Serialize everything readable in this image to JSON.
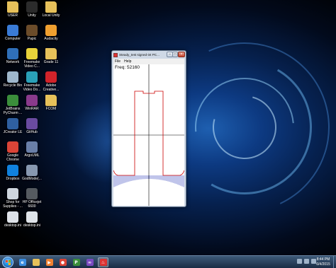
{
  "desktop": {
    "icons": [
      {
        "label": "USER",
        "icon": "folder-icon",
        "color": "#e7c15a"
      },
      {
        "label": "Unity",
        "icon": "unity-icon",
        "color": "#2b2b2b"
      },
      {
        "label": "Local Unity",
        "icon": "folder-icon",
        "color": "#e7c15a"
      },
      {
        "label": "Computer",
        "icon": "computer-icon",
        "color": "#3a7bd5"
      },
      {
        "label": "Papic",
        "icon": "papic-icon",
        "color": "#6b4c2a"
      },
      {
        "label": "Audacity",
        "icon": "audacity-icon",
        "color": "#f0a030"
      },
      {
        "label": "Network",
        "icon": "network-icon",
        "color": "#2f6fb8"
      },
      {
        "label": "Freemake Video C...",
        "icon": "freemake-icon",
        "color": "#e8d23a"
      },
      {
        "label": "Grade 11",
        "icon": "folder-icon",
        "color": "#e7c15a"
      },
      {
        "label": "Recycle Bin",
        "icon": "recycle-bin-icon",
        "color": "#9fb7cc"
      },
      {
        "label": "Freemake Video Do...",
        "icon": "freemake-icon",
        "color": "#2aa0b8"
      },
      {
        "label": "Adobe Creative...",
        "icon": "adobe-cc-icon",
        "color": "#d2232a"
      },
      {
        "label": "JetBrains PyCharm ...",
        "icon": "pycharm-icon",
        "color": "#3b8e3b"
      },
      {
        "label": "WinRAR",
        "icon": "winrar-icon",
        "color": "#8a3a8c"
      },
      {
        "label": "FCOM",
        "icon": "folder-icon",
        "color": "#e7c15a"
      },
      {
        "label": "JCreator LE",
        "icon": "jcreator-icon",
        "color": "#2f5fa0"
      },
      {
        "label": "GitHub",
        "icon": "github-icon",
        "color": "#6a4ba0"
      },
      {
        "label": "Google Chrome",
        "icon": "chrome-icon",
        "color": "#db4437"
      },
      {
        "label": "ArgoUML",
        "icon": "argouml-icon",
        "color": "#6a7fa8"
      },
      {
        "label": "Dropbox",
        "icon": "dropbox-icon",
        "color": "#1081de"
      },
      {
        "label": "GodMode(...",
        "icon": "godmode-icon",
        "color": "#8898b0"
      },
      {
        "label": "Shop for Supplies - ...",
        "icon": "printer-icon",
        "color": "#cfd6de"
      },
      {
        "label": "HP Officejet 6600",
        "icon": "printer-icon",
        "color": "#555a60"
      },
      {
        "label": "desktop.ini",
        "icon": "ini-file-icon",
        "color": "#dfe3e8"
      },
      {
        "label": "desktop.ini",
        "icon": "ini-file-icon",
        "color": "#dfe3e8"
      }
    ]
  },
  "window": {
    "title": "Steady_test signed-int PC...",
    "menu": [
      "File",
      "Help"
    ],
    "freq_label": "Freq: 52160",
    "buttons": {
      "minimize": "–",
      "maximize": "□",
      "close": "×"
    },
    "trace_color": "#cc0000",
    "fill_color": "#2a3cb8"
  },
  "taskbar": {
    "items": [
      {
        "icon": "ie-icon",
        "color": "#3a8de0",
        "glyph": "e"
      },
      {
        "icon": "explorer-icon",
        "color": "#e7c15a",
        "glyph": ""
      },
      {
        "icon": "media-player-icon",
        "color": "#f08030",
        "glyph": "▶"
      },
      {
        "icon": "chrome-icon",
        "color": "#db4437",
        "glyph": "●"
      },
      {
        "icon": "pycharm-icon",
        "color": "#3b8e3b",
        "glyph": "P"
      },
      {
        "icon": "visual-studio-icon",
        "color": "#7a4ac0",
        "glyph": "∞"
      },
      {
        "icon": "java-app-icon",
        "color": "#d33",
        "glyph": "♨"
      }
    ],
    "clock_time": "8:44 PM",
    "clock_date": "6/4/2015"
  }
}
